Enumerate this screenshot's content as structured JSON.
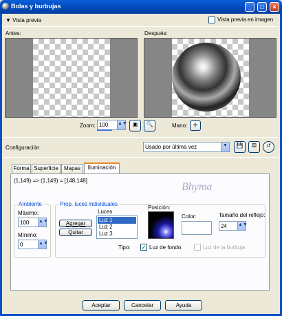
{
  "window": {
    "title": "Bolas y burbujas"
  },
  "preview": {
    "toggle_label": "Vista previa",
    "in_image_label": "Vista previa en imagen",
    "before_label": "Antes:",
    "after_label": "Después:",
    "zoom_label": "Zoom:",
    "zoom_value": "100",
    "hand_label": "Mano:"
  },
  "config": {
    "label": "Configuración",
    "preset_value": "Usado por última vez"
  },
  "tabs": [
    "Forma",
    "Superficie",
    "Mapas",
    "Iluminación"
  ],
  "lighting": {
    "coords_text": "(1,149) => (1,149) = [148,148]",
    "watermark": "Bhyma",
    "ambient": {
      "title": "Ambiente",
      "max_label": "Máximo:",
      "max_value": "100",
      "min_label": "Mínimo:",
      "min_value": "0"
    },
    "props": {
      "title": "Prop. luces individuales",
      "add_label": "Agregar",
      "remove_label": "Quitar",
      "lights_label": "Luces",
      "lights": [
        "Luz 1",
        "Luz 2",
        "Luz 3"
      ],
      "position_label": "Posición:",
      "color_label": "Color:",
      "size_label": "Tamaño del reflejo:",
      "size_value": "24",
      "type_label": "Tipo:",
      "background_light_label": "Luz de fondo",
      "bubble_light_label": "Luz de la burbuja"
    }
  },
  "buttons": {
    "ok": "Aceptar",
    "cancel": "Cancelar",
    "help": "Ayuda"
  }
}
